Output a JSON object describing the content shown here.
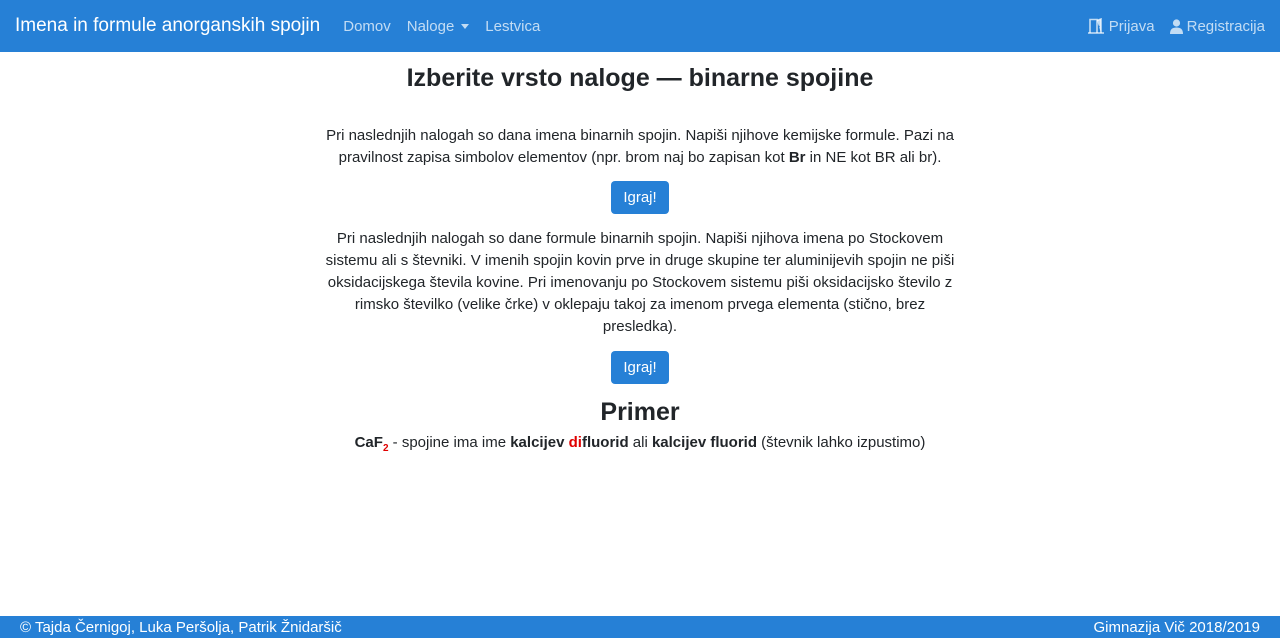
{
  "navbar": {
    "brand": "Imena in formule anorganskih spojin",
    "links": [
      "Domov",
      "Naloge",
      "Lestvica"
    ],
    "login": "Prijava",
    "register": "Registracija"
  },
  "main": {
    "title": "Izberite vrsto naloge — binarne spojine",
    "task1": {
      "text_before": "Pri naslednjih nalogah so dana imena binarnih spojin. Napiši njihove kemijske formule. Pazi na pravilnost zapisa simbolov elementov (npr. brom naj bo zapisan kot ",
      "bold": "Br",
      "text_after": " in NE kot BR ali br).",
      "button": "Igraj!"
    },
    "task2": {
      "text": "Pri naslednjih nalogah so dane formule binarnih spojin. Napiši njihova imena po Stockovem sistemu ali s števniki. V imenih spojin kovin prve in druge skupine ter aluminijevih spojin ne piši oksidacijskega števila kovine. Pri imenovanju po Stockovem sistemu piši oksidacijsko število z rimsko številko (velike črke) v oklepaju takoj za imenom prvega elementa (stično, brez presledka).",
      "button": "Igraj!"
    },
    "example": {
      "title": "Primer",
      "formula": "CaF",
      "subscript": "2",
      "text1": " - spojine ima ime ",
      "name_part1": "kalcijev ",
      "name_prefix": "di",
      "name_part2": "fluorid",
      "text2": " ali ",
      "name_alt": "kalcijev fluorid",
      "text3": " (števnik lahko izpustimo)"
    }
  },
  "footer": {
    "authors": "© Tajda Černigoj, Luka Peršolja, Patrik Žnidaršič",
    "school": "Gimnazija Vič 2018/2019"
  },
  "colors": {
    "primary": "#2680d6",
    "highlight": "#e00000"
  },
  "icons": [
    "door-open-icon",
    "user-icon"
  ]
}
